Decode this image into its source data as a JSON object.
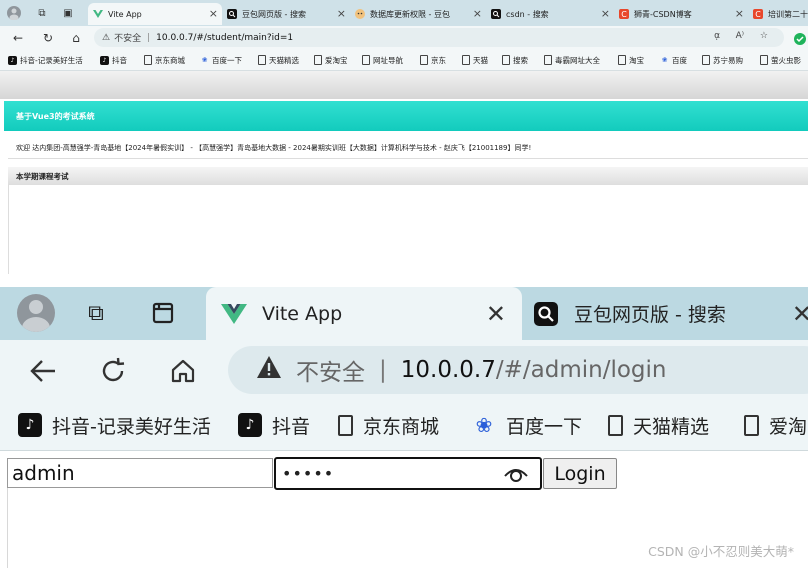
{
  "top_shot": {
    "tabs": [
      {
        "title": "Vite App",
        "icon": "vite-icon",
        "active": true
      },
      {
        "title": "豆包网页版 - 搜索",
        "icon": "search-icon"
      },
      {
        "title": "数据库更新权限 - 豆包",
        "icon": "doubao-icon"
      },
      {
        "title": "csdn - 搜索",
        "icon": "search-icon"
      },
      {
        "title": "狮青-CSDN博客",
        "icon": "csdn-icon"
      },
      {
        "title": "培训第二十",
        "icon": "csdn-icon"
      }
    ],
    "address_bar": {
      "insecure_label": "不安全",
      "url": "10.0.0.7/#/student/main?id=1"
    },
    "bookmarks": [
      "抖音-记录美好生活",
      "抖音",
      "京东商城",
      "百度一下",
      "天猫精选",
      "爱淘宝",
      "网址导航",
      "京东",
      "天猫",
      "搜索",
      "毒霸网址大全",
      "淘宝",
      "百度",
      "苏宁易购",
      "萤火虫影"
    ],
    "page": {
      "system_title": "基于Vue3的考试系统",
      "welcome": "欢迎 达内集团-高慧强学-青岛基地【2024年暑假实训】 - 【高慧强学】青岛基地大数据 - 2024暑期实训班【大数据】计算机科学与技术 - 赵庆飞【21001189】同学!",
      "section_title": "本学期课程考试"
    }
  },
  "bottom_shot": {
    "tabs": [
      {
        "title": "Vite App",
        "icon": "vite-icon",
        "active": true
      },
      {
        "title": "豆包网页版 - 搜索",
        "icon": "search-icon"
      }
    ],
    "address_bar": {
      "insecure_label": "不安全",
      "host": "10.0.0.7",
      "path": "/#/admin/login"
    },
    "bookmarks": [
      "抖音-记录美好生活",
      "抖音",
      "京东商城",
      "百度一下",
      "天猫精选",
      "爱淘"
    ],
    "login_form": {
      "username": "admin",
      "password_mask": "•••••",
      "login_label": "Login"
    }
  },
  "watermark": "CSDN @小不忍则美大萌*",
  "colors": {
    "header_teal": "#1ad3c4",
    "tabbar_bg": "#bcd9e2",
    "vite_accent": "#41b883"
  }
}
